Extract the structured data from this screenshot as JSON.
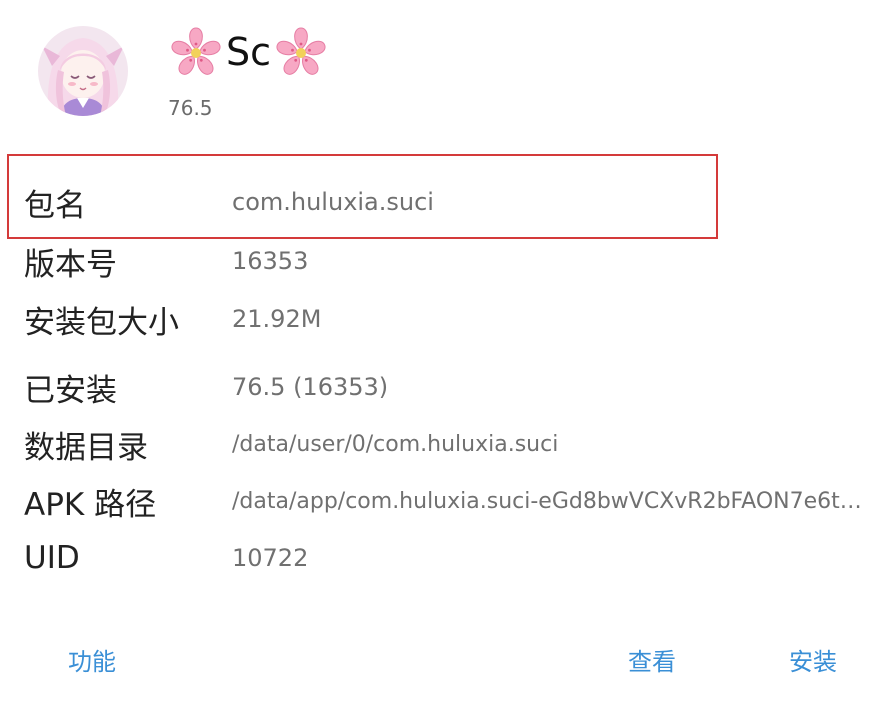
{
  "app": {
    "name": "Sc",
    "version": "76.5",
    "avatar_icon": "avatar-anime-girl",
    "title_decoration_icon": "cherry-blossom"
  },
  "details": [
    {
      "label": "包名",
      "value": "com.huluxia.suci",
      "highlighted": true
    },
    {
      "label": "版本号",
      "value": "16353"
    },
    {
      "label": "安装包大小",
      "value": "21.92M"
    },
    {
      "label": "已安装",
      "value": "76.5 (16353)"
    },
    {
      "label": "数据目录",
      "value": "/data/user/0/com.huluxia.suci"
    },
    {
      "label": "APK 路径",
      "value": "/data/app/com.huluxia.suci-eGd8bwVCXvR2bFAON7e6tA…"
    },
    {
      "label": "UID",
      "value": "10722"
    }
  ],
  "actions": {
    "functions": "功能",
    "view": "查看",
    "install": "安装"
  },
  "colors": {
    "highlight_border": "#d43a3a",
    "action_text": "#3a8fd6",
    "value_text": "#707070",
    "label_text": "#222222"
  }
}
